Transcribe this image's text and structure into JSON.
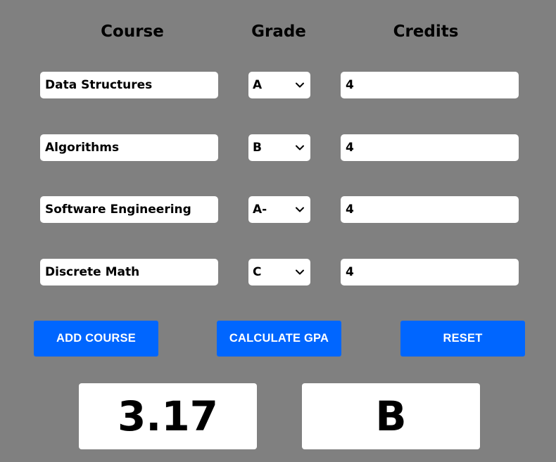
{
  "headers": {
    "course": "Course",
    "grade": "Grade",
    "credits": "Credits"
  },
  "rows": [
    {
      "course": "Data Structures",
      "grade": "A",
      "credits": "4"
    },
    {
      "course": "Algorithms",
      "grade": "B",
      "credits": "4"
    },
    {
      "course": "Software Engineering",
      "grade": "A-",
      "credits": "4"
    },
    {
      "course": "Discrete Math",
      "grade": "C",
      "credits": "4"
    }
  ],
  "buttons": {
    "add": "ADD COURSE",
    "calculate": "CALCULATE GPA",
    "reset": "RESET"
  },
  "results": {
    "gpa": "3.17",
    "letter": "B"
  },
  "colors": {
    "background": "#808080",
    "button": "#0066ff",
    "field": "#ffffff"
  },
  "icons": {
    "dropdown": "chevron-down-icon"
  }
}
